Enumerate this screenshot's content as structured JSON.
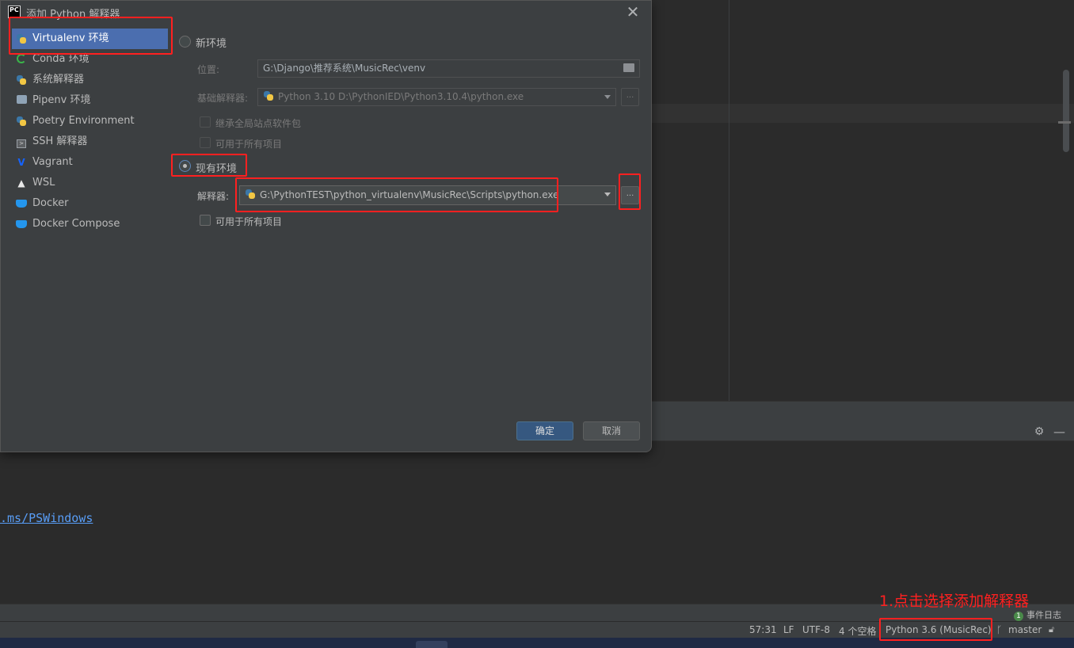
{
  "dialog": {
    "app_icon_text": "PC",
    "title": "添加 Python 解释器"
  },
  "left_nav": {
    "items": [
      {
        "label": "Virtualenv 环境",
        "icon": "python-icon"
      },
      {
        "label": "Conda 环境",
        "icon": "conda-icon"
      },
      {
        "label": "系统解释器",
        "icon": "python-icon"
      },
      {
        "label": "Pipenv 环境",
        "icon": "pipenv-icon"
      },
      {
        "label": "Poetry Environment",
        "icon": "poetry-icon"
      },
      {
        "label": "SSH 解释器",
        "icon": "ssh-icon"
      },
      {
        "label": "Vagrant",
        "icon": "vagrant-icon"
      },
      {
        "label": "WSL",
        "icon": "linux-icon"
      },
      {
        "label": "Docker",
        "icon": "docker-icon"
      },
      {
        "label": "Docker Compose",
        "icon": "docker-compose-icon"
      }
    ],
    "selected_index": 0
  },
  "new_env": {
    "radio_label": "新环境",
    "location_label": "位置:",
    "location_value": "G:\\Django\\推荐系统\\MusicRec\\venv",
    "base_label": "基础解释器:",
    "base_value": "Python 3.10 D:\\PythonIED\\Python3.10.4\\python.exe",
    "inherit_label": "继承全局站点软件包",
    "available_label": "可用于所有项目"
  },
  "existing_env": {
    "radio_label": "现有环境",
    "interpreter_label": "解释器:",
    "interpreter_value": "G:\\PythonTEST\\python_virtualenv\\MusicRec\\Scripts\\python.exe",
    "available_label": "可用于所有项目",
    "browse_label": "..."
  },
  "buttons": {
    "ok": "确定",
    "cancel": "取消"
  },
  "ide": {
    "terminal_link": ".ms/PSWindows",
    "event_log": "事件日志",
    "event_count": "1"
  },
  "status_bar": {
    "position": "57:31",
    "line_sep": "LF",
    "encoding": "UTF-8",
    "indent": "4 个空格",
    "interpreter": "Python 3.6 (MusicRec)",
    "branch": "master"
  },
  "annotation": {
    "text": "1.点击选择添加解释器"
  },
  "colors": {
    "annotation": "#ff2020",
    "selection": "#4b6eaf",
    "primary_button": "#365880"
  }
}
